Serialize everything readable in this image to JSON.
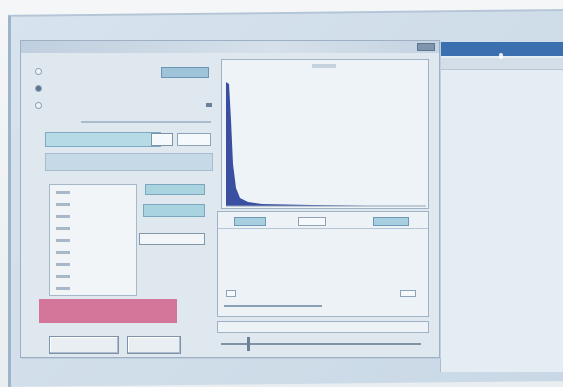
{
  "app": {
    "window_title": ""
  },
  "options": {
    "items": [
      {
        "label": "",
        "selected": false
      },
      {
        "label": "",
        "selected": true
      },
      {
        "label": "",
        "selected": false
      }
    ]
  },
  "buttons": {
    "left_label": "",
    "right_label": ""
  },
  "histogram": {
    "title": ""
  },
  "slider": {
    "position_fraction": 0.13
  },
  "colors": {
    "selection_blue": "#a7cfe0",
    "alert_bar": "#d4769a",
    "histogram_fill": "#3b4fa0"
  }
}
